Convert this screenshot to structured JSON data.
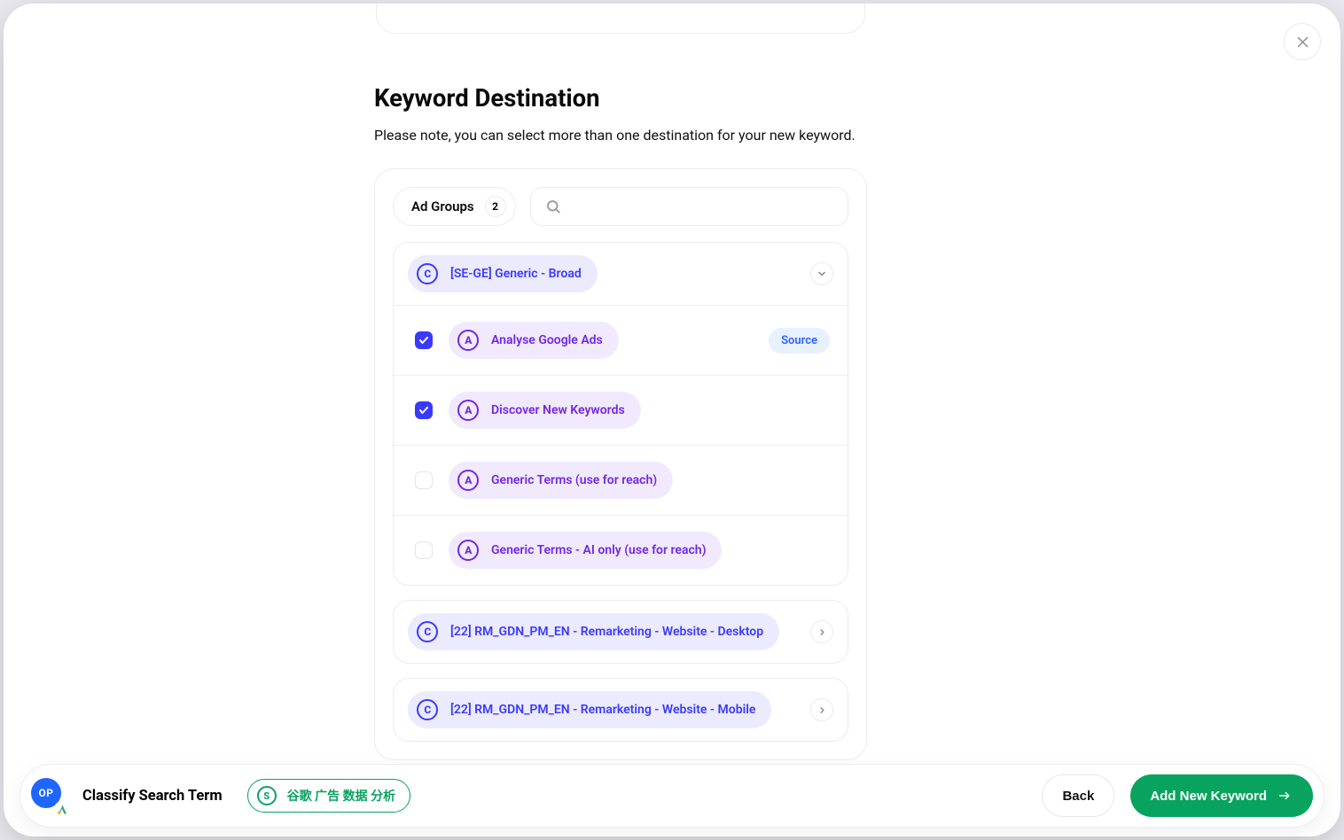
{
  "header": {
    "title": "Keyword Destination",
    "subtitle": "Please note, you can select more than one destination for your new keyword."
  },
  "panel": {
    "pill_label": "Ad Groups",
    "pill_count": "2",
    "search": {
      "placeholder": ""
    },
    "expanded_campaign": {
      "badge_letter": "C",
      "name": "[SE-GE] Generic - Broad",
      "adgroups": [
        {
          "badge": "A",
          "label": "Analyse Google Ads",
          "checked": true,
          "source_label": "Source"
        },
        {
          "badge": "A",
          "label": "Discover New Keywords",
          "checked": true
        },
        {
          "badge": "A",
          "label": "Generic Terms (use for reach)",
          "checked": false
        },
        {
          "badge": "A",
          "label": "Generic Terms - AI only (use for reach)",
          "checked": false
        }
      ]
    },
    "collapsed_campaigns": [
      {
        "badge": "C",
        "name": "[22] RM_GDN_PM_EN - Remarketing - Website - Desktop"
      },
      {
        "badge": "C",
        "name": "[22] RM_GDN_PM_EN - Remarketing - Website - Mobile"
      }
    ]
  },
  "footer": {
    "avatar_initials": "OP",
    "title": "Classify Search Term",
    "term_badge": "S",
    "term_text": "谷歌 广告 数据 分析",
    "back": "Back",
    "primary": "Add New Keyword"
  }
}
